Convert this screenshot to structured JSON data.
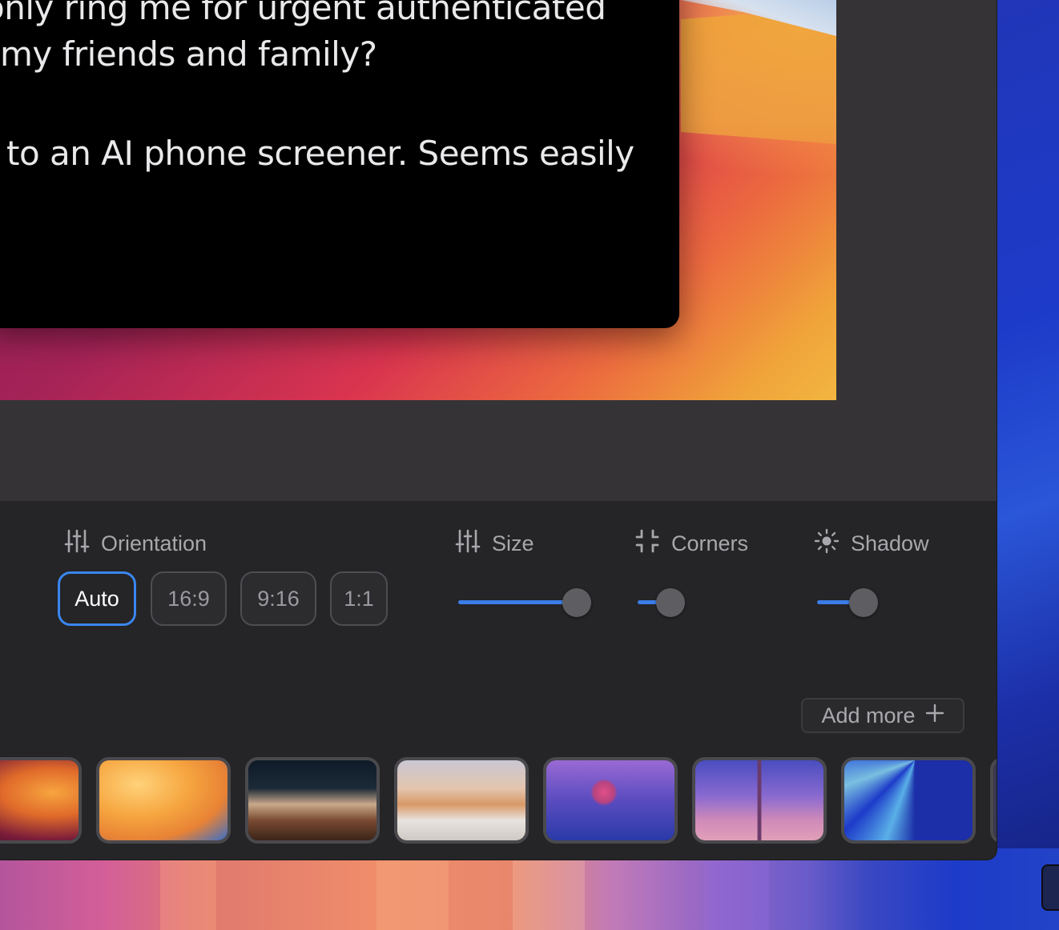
{
  "tweet": {
    "lines": [
      "only ring me for urgent authenticated",
      "my friends and family?",
      "to an AI phone screener. Seems easily"
    ]
  },
  "controls": {
    "orientation": {
      "label": "Orientation",
      "options": [
        "Auto",
        "16:9",
        "9:16",
        "1:1"
      ],
      "selected": "Auto"
    },
    "size": {
      "label": "Size",
      "value": 0.91
    },
    "corners": {
      "label": "Corners",
      "value": 0.55
    },
    "shadow": {
      "label": "Shadow",
      "value": 0.55
    },
    "add_more": {
      "label": "Add more"
    }
  },
  "backgrounds": {
    "thumbnails": [
      "wallpaper-1",
      "wallpaper-2",
      "wallpaper-3",
      "wallpaper-4",
      "wallpaper-5",
      "wallpaper-6",
      "wallpaper-7"
    ]
  },
  "colors": {
    "accent": "#3a86f0",
    "panel": "#252426",
    "canvas": "#353336"
  }
}
